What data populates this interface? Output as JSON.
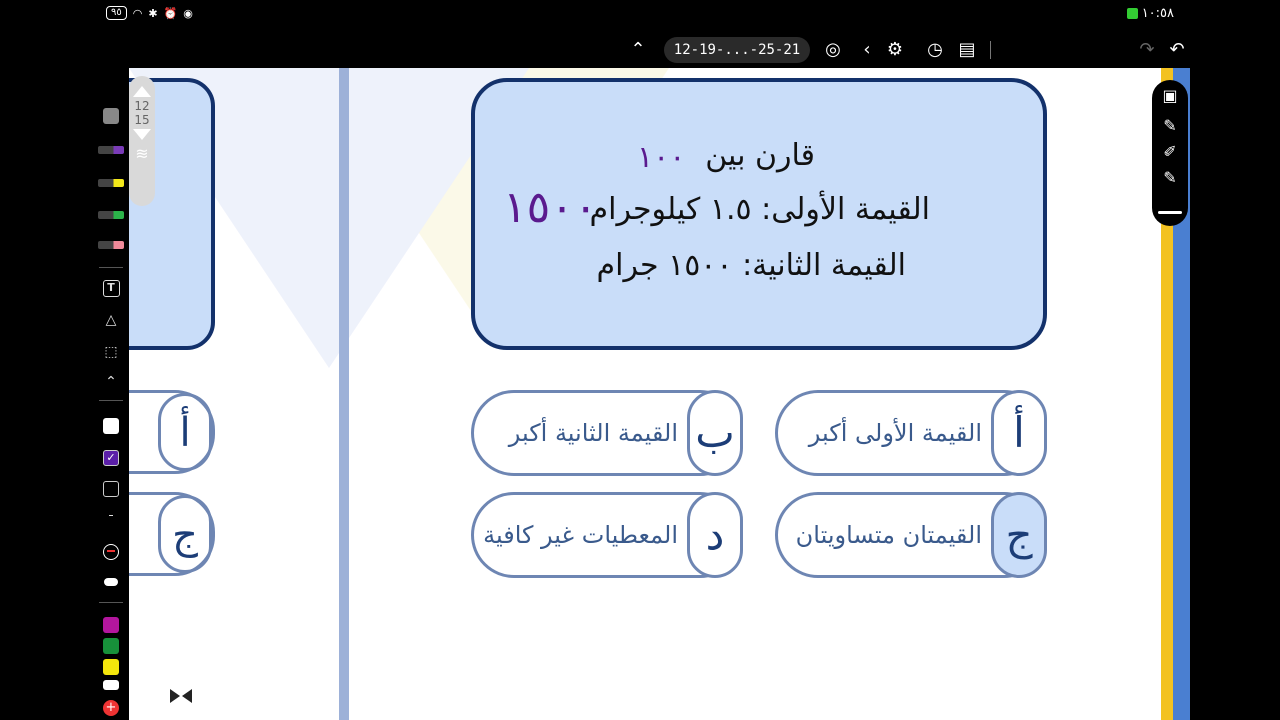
{
  "status": {
    "battery": "٩٥",
    "time": "١٠:٥٨"
  },
  "toolbar": {
    "file_name": "12-19-...-25-21",
    "icons": [
      "chevron-up-icon",
      "eye-icon",
      "chevron-left-icon",
      "gear-icon",
      "clock-icon",
      "search-doc-icon",
      "redo-icon",
      "undo-icon"
    ]
  },
  "page_nav": {
    "current": "12",
    "total": "15"
  },
  "question": {
    "line1": "قارن بين",
    "line2": "القيمة الأولى: ١.٥ كيلوجرام",
    "line3": "القيمة الثانية: ١٥٠٠ جرام",
    "hand_note1": "١٠٠",
    "hand_note2": "١٥٠٠"
  },
  "options": [
    {
      "letter": "أ",
      "text": "القيمة الأولى أكبر",
      "selected": false
    },
    {
      "letter": "ب",
      "text": "القيمة الثانية أكبر",
      "selected": false
    },
    {
      "letter": "ج",
      "text": "القيمتان متساويتان",
      "selected": true
    },
    {
      "letter": "د",
      "text": "المعطيات غير كافية",
      "selected": false
    }
  ],
  "left_page_options": [
    {
      "letter": "أ"
    },
    {
      "letter": "ج"
    }
  ],
  "palette": {
    "colors": [
      "#ffffff",
      "#5b1fa8",
      "#000000",
      "#b3169e",
      "#17913a",
      "#f4e60c",
      "#ffffff"
    ],
    "accent_strip": "#f3c221",
    "accent_blue": "#4a7fd1"
  }
}
